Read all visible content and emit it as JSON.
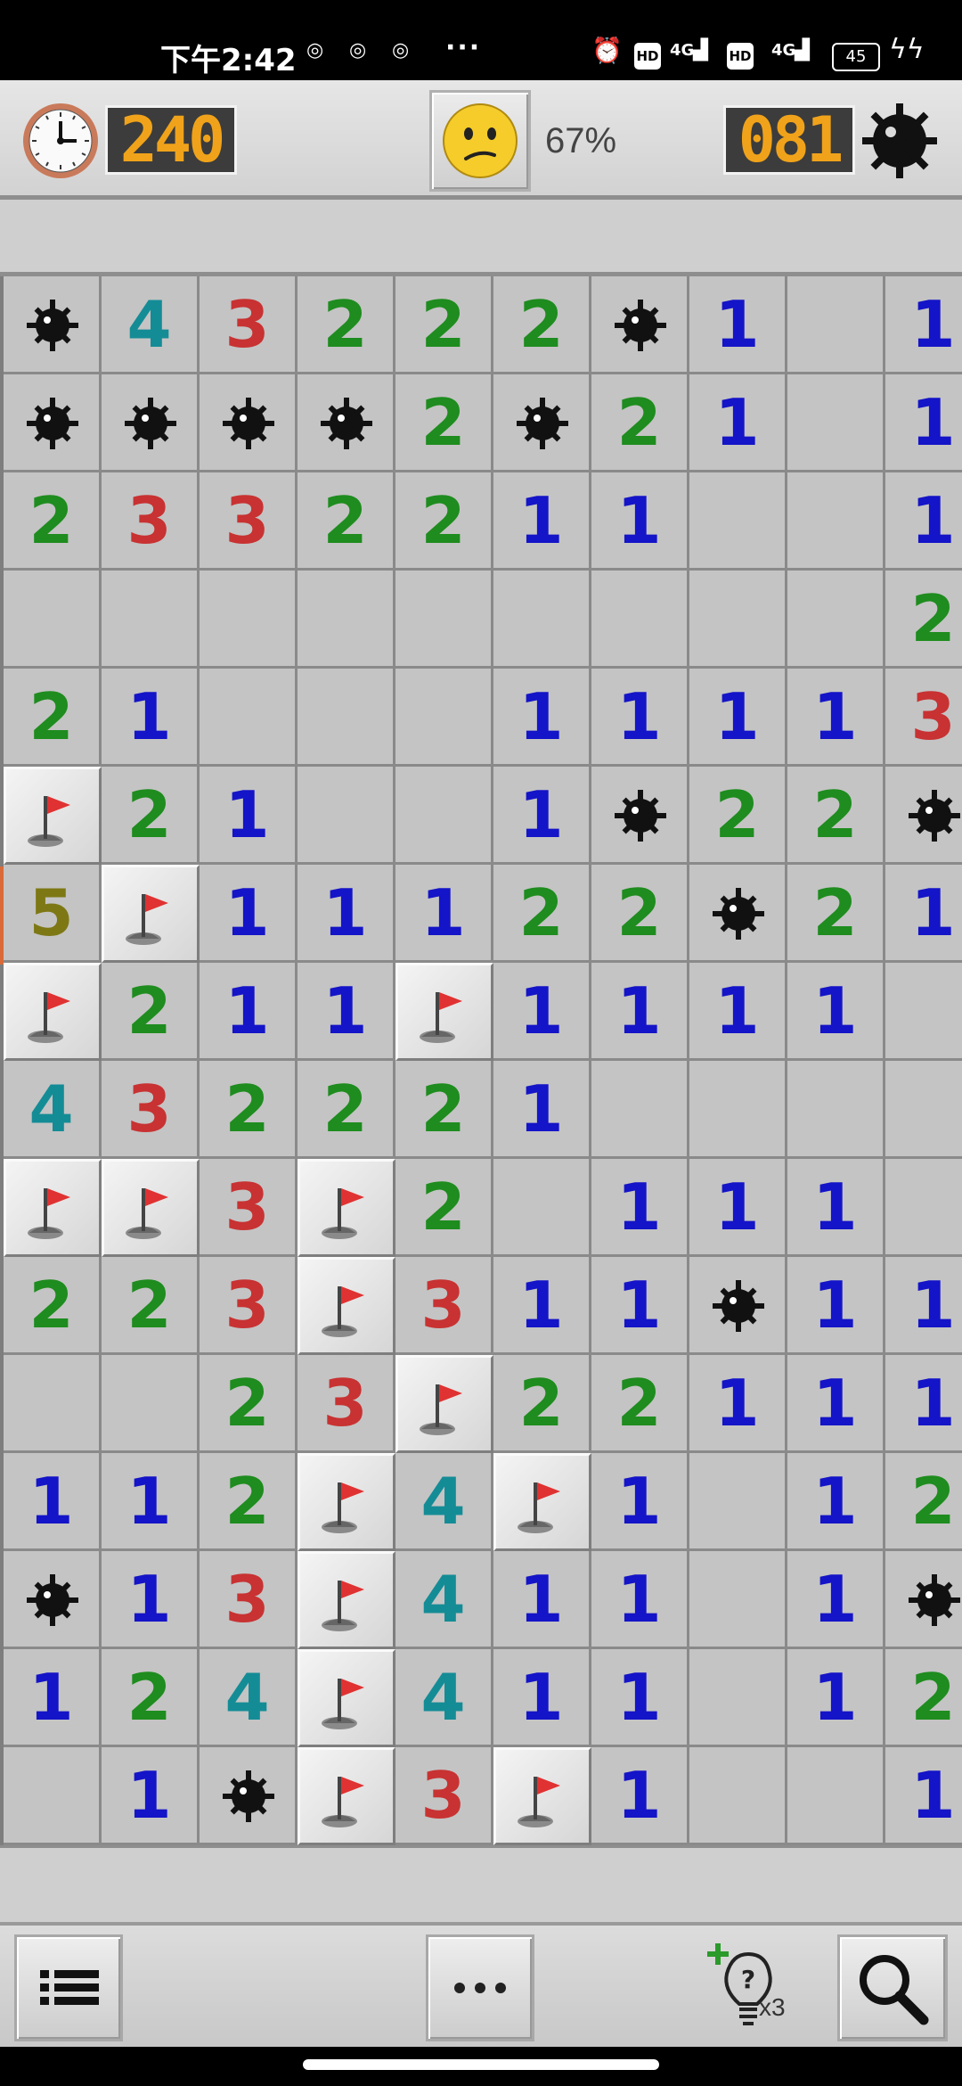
{
  "status_bar": {
    "time": "下午2:42",
    "more": "···",
    "net1": "4G",
    "net2": "4G",
    "hd": "HD",
    "battery": "45"
  },
  "header": {
    "timer": "240",
    "progress": "67%",
    "mines_remaining": "081",
    "face": "confused-face"
  },
  "colors": {
    "1": "#1414c8",
    "2": "#1e8c1e",
    "3": "#c83232",
    "4": "#148c96",
    "5": "#7d7814",
    "lcd_digits": "#f0a31a",
    "flag": "#e03232"
  },
  "board": {
    "visible_columns": 10,
    "rows": [
      [
        "M",
        "4",
        "3",
        "2",
        "2",
        "2",
        "M",
        "1",
        "",
        "1"
      ],
      [
        "M",
        "M",
        "M",
        "M",
        "2",
        "M",
        "2",
        "1",
        "",
        "1"
      ],
      [
        "2",
        "3",
        "3",
        "2",
        "2",
        "1",
        "1",
        "",
        "",
        "1"
      ],
      [
        "",
        "",
        "",
        "",
        "",
        "",
        "",
        "",
        "",
        "2"
      ],
      [
        "2",
        "1",
        "",
        "",
        "",
        "1",
        "1",
        "1",
        "1",
        "3"
      ],
      [
        "F",
        "2",
        "1",
        "",
        "",
        "1",
        "M",
        "2",
        "2",
        "M"
      ],
      [
        "5",
        "F",
        "1",
        "1",
        "1",
        "2",
        "2",
        "M",
        "2",
        "1"
      ],
      [
        "F",
        "2",
        "1",
        "1",
        "F",
        "1",
        "1",
        "1",
        "1",
        ""
      ],
      [
        "4",
        "3",
        "2",
        "2",
        "2",
        "1",
        "",
        "",
        "",
        ""
      ],
      [
        "F",
        "F",
        "3",
        "F",
        "2",
        "",
        "1",
        "1",
        "1",
        ""
      ],
      [
        "2",
        "2",
        "3",
        "F",
        "3",
        "1",
        "1",
        "M",
        "1",
        "1"
      ],
      [
        "",
        "",
        "2",
        "3",
        "F",
        "2",
        "2",
        "1",
        "1",
        "1"
      ],
      [
        "1",
        "1",
        "2",
        "F",
        "4",
        "F",
        "1",
        "",
        "1",
        "2"
      ],
      [
        "M",
        "1",
        "3",
        "F",
        "4",
        "1",
        "1",
        "",
        "1",
        "M"
      ],
      [
        "1",
        "2",
        "4",
        "F",
        "4",
        "1",
        "1",
        "",
        "1",
        "2"
      ],
      [
        "",
        "1",
        "M",
        "F",
        "3",
        "F",
        "1",
        "",
        "",
        "1"
      ]
    ]
  },
  "toolbar": {
    "hint_count": "x3",
    "menu_icon": "list-icon",
    "more_label": "•••",
    "hint_icon": "lightbulb-hint-icon",
    "search_icon": "magnifier-icon"
  }
}
